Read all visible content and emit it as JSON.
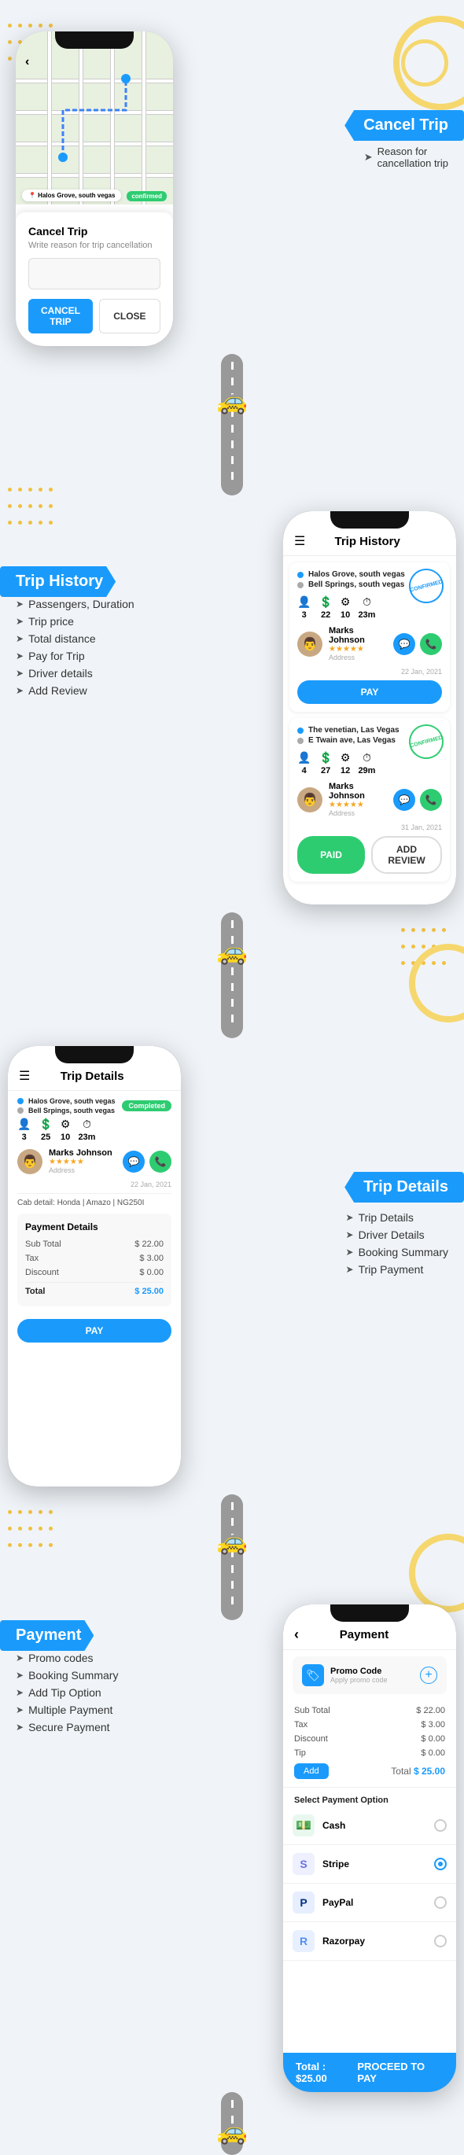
{
  "colors": {
    "blue": "#1a9bfc",
    "green": "#2ecc71",
    "yellow": "#f5d76e",
    "dark": "#111",
    "gray": "#f0f4f8"
  },
  "section1": {
    "label": "Cancel Trip",
    "features": [
      "Reason for cancellation trip"
    ],
    "modal": {
      "title": "Cancel Trip",
      "placeholder": "Write reason for trip cancellation",
      "cancelBtn": "CANCEL TRIP",
      "closeBtn": "CLOSE"
    }
  },
  "section2": {
    "label": "Trip History",
    "features": [
      "Passengers, Duration",
      "Trip price",
      "Total distance",
      "Pay for Trip",
      "Driver details",
      "Add Review"
    ],
    "header": "Trip History",
    "menuIcon": "☰",
    "trips": [
      {
        "from": "Halos Grove, south vegas",
        "to": "Bell Springs, south vegas",
        "fromDot": "blue",
        "toDot": "gray",
        "stats": [
          {
            "icon": "👤",
            "val": "3"
          },
          {
            "icon": "💲",
            "val": "22"
          },
          {
            "icon": "⚙",
            "val": "10"
          },
          {
            "icon": "⏱",
            "val": "23m"
          }
        ],
        "driver": "Marks Johnson",
        "stars": "★★★★★",
        "address": "Address",
        "date": "22 Jan, 2021",
        "status": "pay",
        "stamp": "CONFIRMED",
        "btnLabel": "PAY"
      },
      {
        "from": "The venetian, Las Vegas",
        "to": "E Twain ave, Las Vegas",
        "fromDot": "blue",
        "toDot": "gray",
        "stats": [
          {
            "icon": "👤",
            "val": "4"
          },
          {
            "icon": "💲",
            "val": "27"
          },
          {
            "icon": "⚙",
            "val": "12"
          },
          {
            "icon": "⏱",
            "val": "29m"
          }
        ],
        "driver": "Marks Johnson",
        "stars": "★★★★★",
        "address": "Address",
        "date": "31 Jan, 2021",
        "status": "paid",
        "stamp": "CONFIRMED",
        "btnLabel1": "PAID",
        "btnLabel2": "ADD REVIEW"
      }
    ]
  },
  "section3": {
    "label": "Trip Details",
    "features": [
      "Trip Details",
      "Driver Details",
      "Booking Summary",
      "Trip Payment"
    ],
    "header": "Trip Details",
    "from": "Halos Grove, south vegas",
    "to": "Bell Srpings, south vegas",
    "status": "Completed",
    "stats": [
      {
        "icon": "👤",
        "val": "3"
      },
      {
        "icon": "💲",
        "val": "25"
      },
      {
        "icon": "⚙",
        "val": "10"
      },
      {
        "icon": "⏱",
        "val": "23m"
      }
    ],
    "driver": "Marks Johnson",
    "stars": "★★★★★",
    "address": "Address",
    "date": "22 Jan, 2021",
    "cabDetail": "Cab detail: Honda | Amazo | NG250I",
    "payment": {
      "title": "Payment Details",
      "subTotal": {
        "label": "Sub Total",
        "value": "$ 22.00"
      },
      "tax": {
        "label": "Tax",
        "value": "$ 3.00"
      },
      "discount": {
        "label": "Discount",
        "value": "$ 0.00"
      },
      "total": {
        "label": "Total",
        "value": "$ 25.00"
      }
    },
    "payBtn": "PAY"
  },
  "section4": {
    "label": "Payment",
    "features": [
      "Promo codes",
      "Booking Summary",
      "Add Tip Option",
      "Multiple Payment",
      "Secure Payment"
    ],
    "header": "Payment",
    "backIcon": "‹",
    "promo": {
      "label": "Promo Code",
      "placeholder": "Apply promo code"
    },
    "payment": {
      "subTotal": {
        "label": "Sub Total",
        "value": "$ 22.00"
      },
      "tax": {
        "label": "Tax",
        "value": "$ 3.00"
      },
      "discount": {
        "label": "Discount",
        "value": "$ 0.00"
      },
      "tip": {
        "label": "Tip",
        "value": "$ 0.00"
      },
      "addTip": "Add",
      "total": {
        "label": "Total",
        "value": "$ 25.00"
      }
    },
    "selectPaymentLabel": "Select Payment Option",
    "paymentOptions": [
      {
        "name": "Cash",
        "icon": "💵",
        "color": "#2ecc71",
        "selected": false
      },
      {
        "name": "Stripe",
        "icon": "S",
        "color": "#6772e5",
        "selected": true
      },
      {
        "name": "PayPal",
        "icon": "P",
        "color": "#003087",
        "selected": false
      },
      {
        "name": "Razorpay",
        "icon": "R",
        "color": "#528ff0",
        "selected": false
      }
    ],
    "proceed": {
      "total": "Total : $25.00",
      "btn": "PROCEED TO PAY"
    }
  }
}
